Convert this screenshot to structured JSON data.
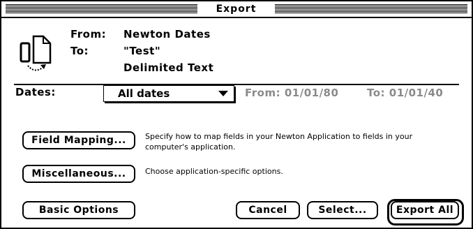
{
  "window": {
    "title": "Export"
  },
  "summary": {
    "from_label": "From:",
    "from_value": "Newton Dates",
    "to_label": "To:",
    "to_value": "\"Test\"",
    "format_value": "Delimited Text"
  },
  "dates": {
    "label": "Dates:",
    "selected": "All dates",
    "from_text": "From: 01/01/80",
    "to_text": "To: 01/01/40"
  },
  "options": {
    "field_mapping_button": "Field Mapping...",
    "field_mapping_desc_line1": "Specify how to map fields in your Newton Application to fields in your",
    "field_mapping_desc_line2": "computer's application.",
    "misc_button": "Miscellaneous...",
    "misc_desc": "Choose application-specific options."
  },
  "footer": {
    "basic_options_button": "Basic Options",
    "cancel_button": "Cancel",
    "select_button": "Select...",
    "export_all_button": "Export All"
  }
}
